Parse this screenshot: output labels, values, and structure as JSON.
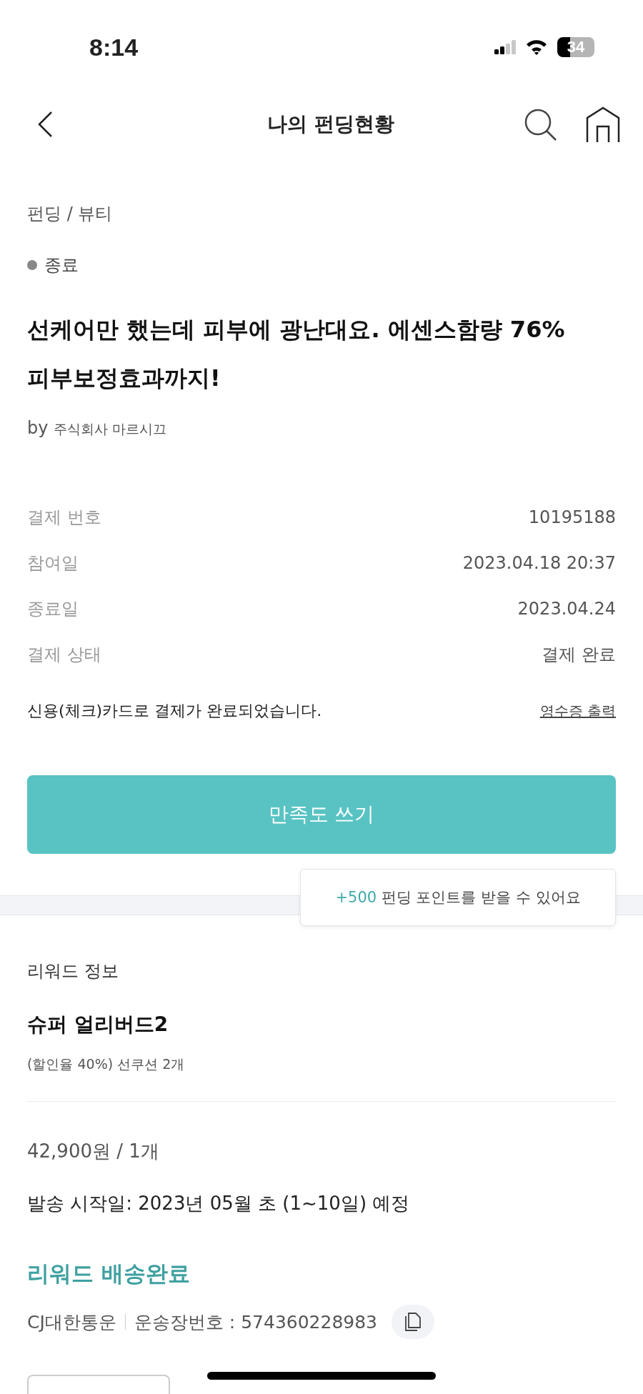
{
  "status_bar": {
    "time": "8:14",
    "battery": "34"
  },
  "header": {
    "title": "나의 펀딩현황"
  },
  "project": {
    "category": "펀딩 / 뷰티",
    "status": "종료",
    "title": "선케어만 했는데 피부에 광난대요. 에센스함량 76% 피부보정효과까지!",
    "by": "by",
    "maker": "주식회사 마르시끄"
  },
  "payment": {
    "rows": [
      {
        "label": "결제 번호",
        "value": "10195188"
      },
      {
        "label": "참여일",
        "value": "2023.04.18 20:37"
      },
      {
        "label": "종료일",
        "value": "2023.04.24"
      },
      {
        "label": "결제 상태",
        "value": "결제 완료"
      }
    ],
    "note": "신용(체크)카드로 결제가 완료되었습니다.",
    "receipt_link": "영수증 출력"
  },
  "review_button": "만족도 쓰기",
  "tooltip": {
    "points": "+500",
    "text": "펀딩 포인트를 받을 수 있어요"
  },
  "reward": {
    "section": "리워드 정보",
    "name": "슈퍼 얼리버드2",
    "options": "(할인율 40%) 선쿠션 2개",
    "price": "42,900원 / 1개",
    "ship_date": "발송 시작일: 2023년 05월 초 (1~10일) 예정",
    "delivery_status": "리워드 배송완료",
    "carrier": "CJ대한통운",
    "tracking": "운송장번호 : 574360228983"
  }
}
